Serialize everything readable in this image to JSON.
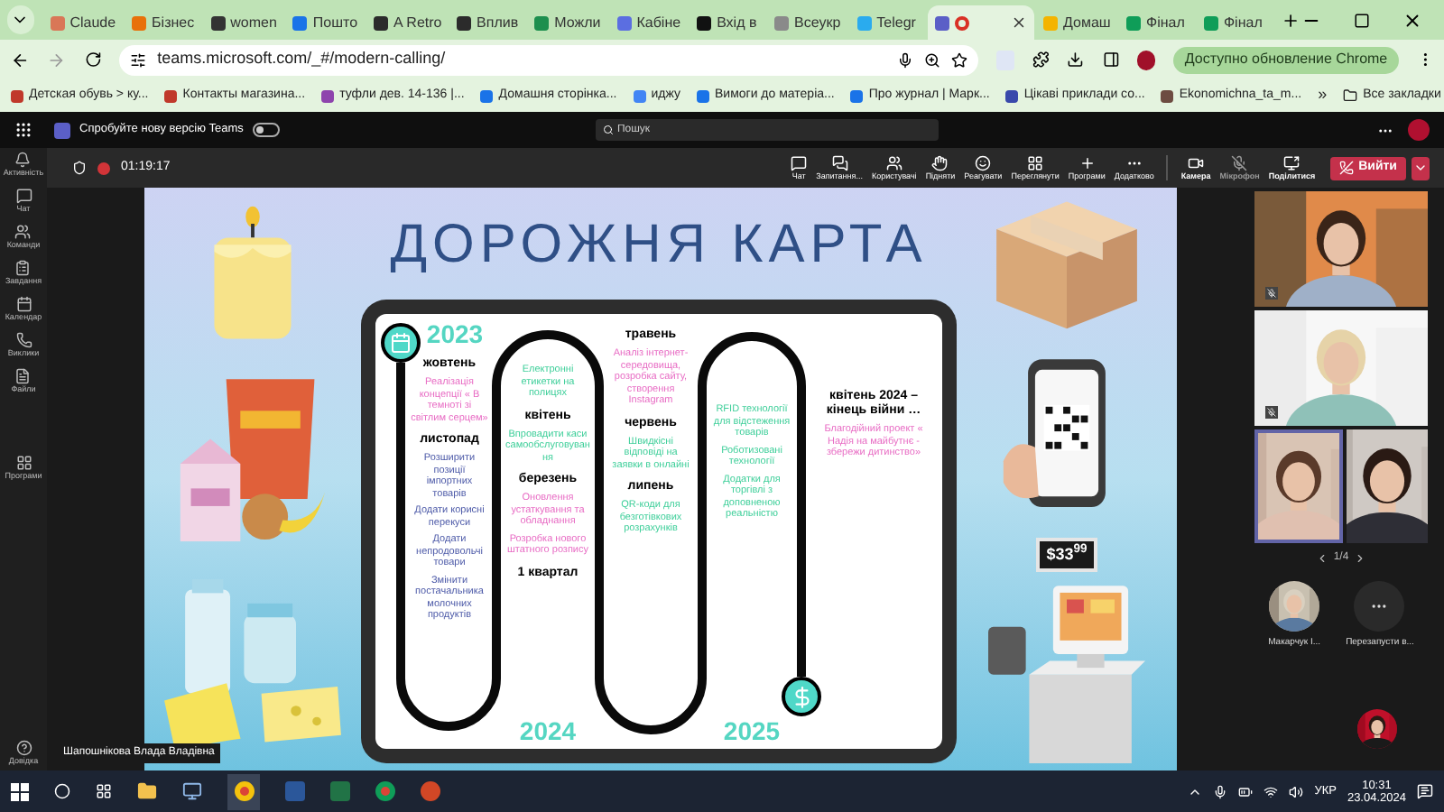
{
  "browser": {
    "tabs": [
      {
        "title": "Claude",
        "color": "#d97757",
        "selected": false,
        "recording": false
      },
      {
        "title": "Бізнес",
        "color": "#e8710a",
        "selected": false,
        "recording": false
      },
      {
        "title": "women",
        "color": "#333333",
        "selected": false,
        "recording": false
      },
      {
        "title": "Пошто",
        "color": "#1a73e8",
        "selected": false,
        "recording": false
      },
      {
        "title": "A Retro",
        "color": "#2b2b2b",
        "selected": false,
        "recording": false
      },
      {
        "title": "Вплив",
        "color": "#2b2b2b",
        "selected": false,
        "recording": false
      },
      {
        "title": "Можли",
        "color": "#1d8f4e",
        "selected": false,
        "recording": false
      },
      {
        "title": "Кабіне",
        "color": "#5b6ee1",
        "selected": false,
        "recording": false
      },
      {
        "title": "Вхід в",
        "color": "#111111",
        "selected": false,
        "recording": false
      },
      {
        "title": "Всеукр",
        "color": "#8a8a8a",
        "selected": false,
        "recording": false
      },
      {
        "title": "Telegr",
        "color": "#2aabee",
        "selected": false,
        "recording": false
      },
      {
        "color": "#5b5fc7",
        "selected": true,
        "recording": true
      },
      {
        "title": "Домаш",
        "color": "#f4b400",
        "selected": false,
        "recording": false
      },
      {
        "title": "Фінал",
        "color": "#0f9d58",
        "selected": false,
        "recording": false
      },
      {
        "title": "Фінал",
        "color": "#0f9d58",
        "selected": false,
        "recording": false
      }
    ],
    "url": "teams.microsoft.com/_#/modern-calling/",
    "update_button": "Доступно обновление Chrome",
    "bookmarks": [
      {
        "title": "Детская обувь > ку...",
        "color": "#c0392b"
      },
      {
        "title": "Контакты магазина...",
        "color": "#c0392b"
      },
      {
        "title": "туфли дев. 14-136 |...",
        "color": "#8e44ad"
      },
      {
        "title": "Домашня сторінка...",
        "color": "#1a73e8"
      },
      {
        "title": "иджу",
        "color": "#4285f4"
      },
      {
        "title": "Вимоги до матеріа...",
        "color": "#1a73e8"
      },
      {
        "title": "Про журнал | Марк...",
        "color": "#1a73e8"
      },
      {
        "title": "Цікаві приклади со...",
        "color": "#3949ab"
      },
      {
        "title": "Ekonomichna_ta_m...",
        "color": "#6d4c41"
      }
    ],
    "more_bookmarks": "»",
    "all_bookmarks": "Все закладки"
  },
  "teams": {
    "new_version": {
      "label": "Спробуйте нову версію Teams",
      "on": false
    },
    "search": {
      "placeholder": "Пошук"
    },
    "rail": [
      "Активність",
      "Чат",
      "Команди",
      "Завдання",
      "Календар",
      "Виклики",
      "Файли",
      "Програми",
      "Довідка"
    ],
    "call_time": "01:19:17",
    "toolbar": [
      "Чат",
      "Запитання...",
      "Користувачі",
      "Підняти",
      "Реагувати",
      "Переглянути",
      "Програми",
      "Додатково"
    ],
    "devices": [
      {
        "label": "Камера",
        "on": true
      },
      {
        "label": "Мікрофон",
        "on": false
      },
      {
        "label": "Поділитися",
        "on": true
      }
    ],
    "leave_button": "Вийти",
    "presenter": "Шапошнікова Влада Владівна",
    "tiles": [
      {
        "highlighted": false
      },
      {
        "highlighted": false
      },
      {
        "highlighted": true
      },
      {
        "highlighted": false
      }
    ],
    "pager": "1/4",
    "participants": [
      "Макарчук І...",
      "Перезапусти в..."
    ]
  },
  "slide": {
    "title": "ДОРОЖНЯ КАРТА",
    "price_tag": "$33$^{99}$",
    "columns": [
      [
        {
          "kind": "year",
          "text": "2023",
          "color": "#55d6c2"
        },
        {
          "kind": "month",
          "text": "жовтень"
        },
        {
          "kind": "note",
          "text": "Реалізація концепції « В темноті зі світлим серцем»",
          "color": "#e86cc4"
        },
        {
          "kind": "month",
          "text": "листопад"
        },
        {
          "kind": "note",
          "text": "Розширити позиції імпортних товарів",
          "color": "#4d5aa8"
        },
        {
          "kind": "note",
          "text": "Додати корисні перекуси",
          "color": "#4d5aa8"
        },
        {
          "kind": "note",
          "text": "Додати непродовольчі товари",
          "color": "#4d5aa8"
        },
        {
          "kind": "note",
          "text": "Змінити постачальника молочних продуктів",
          "color": "#4d5aa8"
        }
      ],
      [
        {
          "kind": "note",
          "text": "Електронні етикетки на полицях",
          "color": "#3fcf9a"
        },
        {
          "kind": "month",
          "text": "квітень"
        },
        {
          "kind": "note",
          "text": "Впровадити каси самообслуговування",
          "color": "#3fcf9a"
        },
        {
          "kind": "month",
          "text": "березень"
        },
        {
          "kind": "note",
          "text": "Оновлення устаткування та обладнання",
          "color": "#e86cc4"
        },
        {
          "kind": "note",
          "text": "Розробка нового штатного розпису",
          "color": "#e86cc4"
        },
        {
          "kind": "month",
          "text": "1 квартал"
        },
        {
          "kind": "year",
          "text": "2024",
          "color": "#55d6c2"
        }
      ],
      [
        {
          "kind": "month",
          "text": "травень"
        },
        {
          "kind": "note",
          "text": "Аналіз інтернет-середовища, розробка сайту, створення Instagram",
          "color": "#e86cc4"
        },
        {
          "kind": "month",
          "text": "червень"
        },
        {
          "kind": "note",
          "text": "Швидкісні відповіді на заявки в онлайні",
          "color": "#3fcf9a"
        },
        {
          "kind": "month",
          "text": "липень"
        },
        {
          "kind": "note",
          "text": "QR-коди для безготівкових розрахунків",
          "color": "#3fcf9a"
        }
      ],
      [
        {
          "kind": "note",
          "text": "RFID технології для відстеження товарів",
          "color": "#3fcf9a"
        },
        {
          "kind": "note",
          "text": "Роботизовані технології",
          "color": "#3fcf9a"
        },
        {
          "kind": "note",
          "text": "Додатки для торгівлі з доповненою реальністю",
          "color": "#3fcf9a"
        },
        {
          "kind": "year",
          "text": "2025",
          "color": "#55d6c2"
        }
      ],
      [
        {
          "kind": "month",
          "text": "квітень 2024 – кінець війни …"
        },
        {
          "kind": "note",
          "text": "Благодійний проект « Надія на майбутнє - збережи дитинство»",
          "color": "#e86cc4"
        }
      ]
    ]
  },
  "taskbar": {
    "language": "УКР",
    "time": "10:31",
    "date": "23.04.2024"
  }
}
